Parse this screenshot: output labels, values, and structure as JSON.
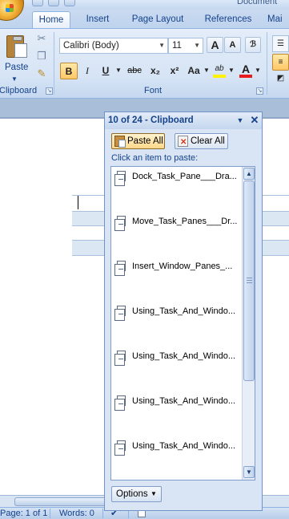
{
  "window": {
    "doc_title_fragment": "Document"
  },
  "ribbon": {
    "tabs": [
      "Home",
      "Insert",
      "Page Layout",
      "References",
      "Mai"
    ],
    "active_tab": "Home",
    "clipboard_group": {
      "label": "Clipboard",
      "paste_label": "Paste"
    },
    "font_group": {
      "label": "Font",
      "font_name": "Calibri (Body)",
      "font_size": "11",
      "bold": "B",
      "italic": "I",
      "underline": "U",
      "strikethrough": "abc",
      "subscript": "x₂",
      "superscript": "x²",
      "change_case": "Aa",
      "grow_font": "A",
      "shrink_font": "A",
      "highlight": "ab",
      "font_color": "A"
    }
  },
  "clipboard_pane": {
    "title": "10 of 24 - Clipboard",
    "paste_all_label": "Paste All",
    "clear_all_label": "Clear All",
    "hint": "Click an item to paste:",
    "items": [
      "Dock_Task_Pane___Dra...",
      "Move_Task_Panes___Dr...",
      "Insert_Window_Panes_...",
      "Using_Task_And_Windo...",
      "Using_Task_And_Windo...",
      "Using_Task_And_Windo...",
      "Using_Task_And_Windo..."
    ],
    "options_label": "Options"
  },
  "statusbar": {
    "page": "Page: 1 of 1",
    "words": "Words: 0"
  },
  "colors": {
    "ribbon_bg": "#d6e4f5",
    "accent_text": "#15428b",
    "button_pressed": "#ffc766",
    "font_color_bar": "#e81c1c",
    "highlight_bar": "#fff200"
  }
}
